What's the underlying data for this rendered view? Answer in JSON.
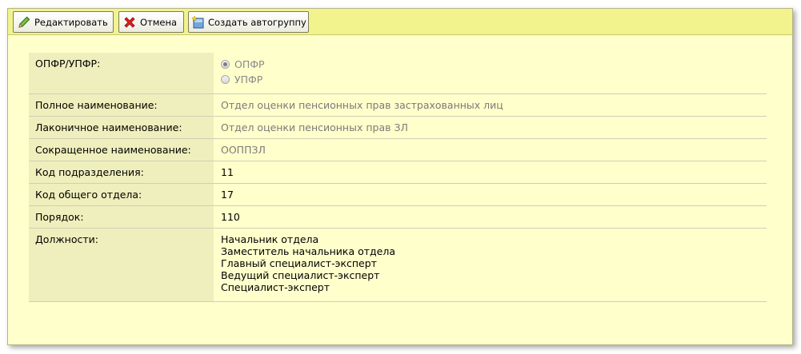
{
  "toolbar": {
    "edit_label": "Редактировать",
    "cancel_label": "Отмена",
    "create_group_label": "Создать автогруппу"
  },
  "form": {
    "opfr": {
      "label": "ОПФР/УПФР:",
      "options": [
        "ОПФР",
        "УПФР"
      ],
      "selected": "ОПФР"
    },
    "full_name": {
      "label": "Полное наименование:",
      "value": "Отдел оценки пенсионных прав застрахованных лиц"
    },
    "laconic_name": {
      "label": "Лаконичное наименование:",
      "value": "Отдел оценки пенсионных прав ЗЛ"
    },
    "short_name": {
      "label": "Сокращенное наименование:",
      "value": "ООППЗЛ"
    },
    "division_code": {
      "label": "Код подразделения:",
      "value": "11"
    },
    "common_dept_code": {
      "label": "Код общего отдела:",
      "value": "17"
    },
    "order": {
      "label": "Порядок:",
      "value": "110"
    },
    "positions": {
      "label": "Должности:",
      "items": [
        "Начальник отдела",
        "Заместитель начальника отдела",
        "Главный специалист-эксперт",
        "Ведущий специалист-эксперт",
        "Специалист-эксперт"
      ]
    }
  },
  "colors": {
    "panel_bg": "#ffffcc",
    "toolbar_bg": "#f3f38d",
    "label_bg": "#efefbd"
  },
  "icons": {
    "edit": "pencil-icon",
    "cancel": "red-x-icon",
    "create_group": "new-group-icon"
  }
}
